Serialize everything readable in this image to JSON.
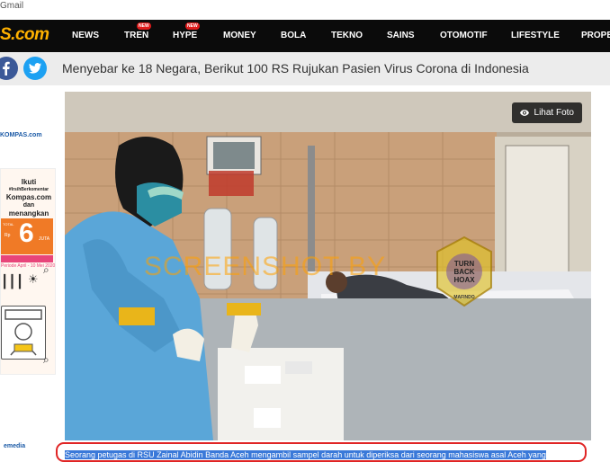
{
  "browser": {
    "bookmark_label": "Gmail"
  },
  "navbar": {
    "logo_text": "S.com",
    "items": [
      {
        "label": "NEWS"
      },
      {
        "label": "TREN",
        "badge": "NEW"
      },
      {
        "label": "HYPE",
        "badge": "NEW"
      },
      {
        "label": "MONEY"
      },
      {
        "label": "BOLA"
      },
      {
        "label": "TEKNO"
      },
      {
        "label": "SAINS"
      },
      {
        "label": "OTOMOTIF"
      },
      {
        "label": "LIFESTYLE"
      },
      {
        "label": "PROPE"
      }
    ],
    "colors": {
      "background": "#0b0b0b",
      "logo": "#ffb100",
      "badge": "#e01b1b"
    }
  },
  "sharebar": {
    "headline": "Menyebar ke 18 Negara, Berikut 100 RS Rujukan Pasien Virus Corona di Indonesia",
    "icons": [
      "facebook-icon",
      "twitter-icon"
    ]
  },
  "sidebar": {
    "logo_text": "KOMPAS.com",
    "ad": {
      "line1": "Ikuti",
      "line2": "#IrsihBerkomentar",
      "line3": "Kompas.com",
      "line4": "dan",
      "line5": "menangkan",
      "total_label": "TOTAL",
      "rp_label": "Rp",
      "amount": "6",
      "unit": "JUTA",
      "period_label": "Periode",
      "period_dates": "April - 10 Mei 2020"
    },
    "footer_logo": "emedia"
  },
  "photo": {
    "view_button": "Lihat Foto",
    "watermark": "SCREENSHOT BY",
    "badge_text": {
      "turn": "TURN",
      "back": "BACK",
      "hoax": "HOAX",
      "org": "MAFINDO"
    }
  },
  "caption": {
    "text": "Seorang petugas di RSU Zainal Abidin Banda Aceh mengambil sampel darah untuk diperiksa dari seorang mahasiswa asal Aceh yang"
  }
}
